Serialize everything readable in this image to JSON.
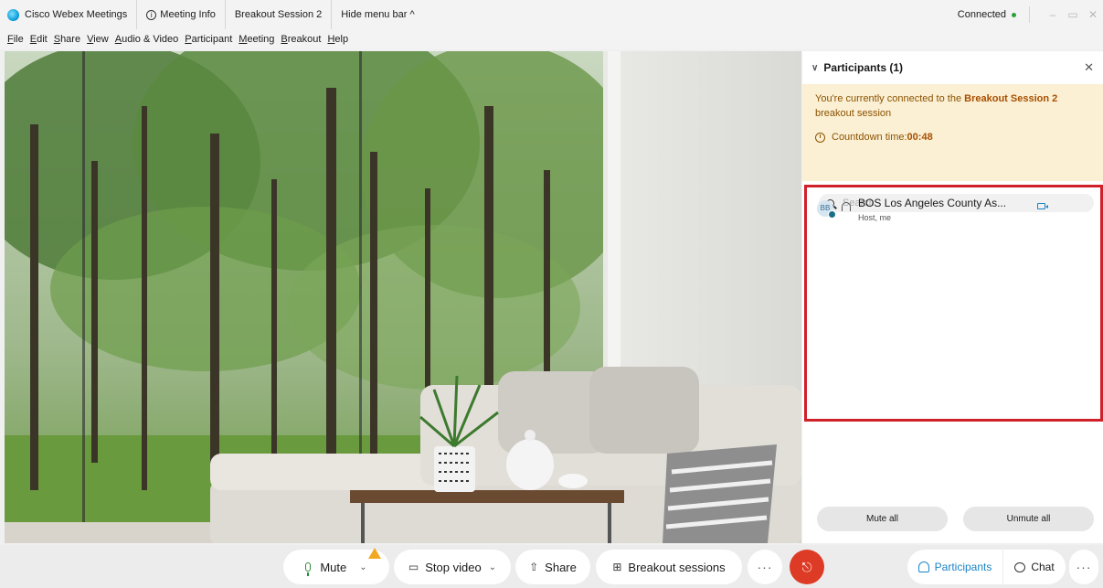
{
  "titlebar": {
    "app_name": "Cisco Webex Meetings",
    "meeting_info": "Meeting Info",
    "session": "Breakout Session 2",
    "hide_menu": "Hide menu bar ^",
    "status": "Connected",
    "minimize": "–",
    "maximize": "▭",
    "close": "✕"
  },
  "menubar": {
    "items": [
      "File",
      "Edit",
      "Share",
      "View",
      "Audio & Video",
      "Participant",
      "Meeting",
      "Breakout",
      "Help"
    ]
  },
  "panel": {
    "title": "Participants (1)",
    "banner_prefix": "You're currently connected to the ",
    "banner_session": "Breakout Session 2",
    "banner_suffix": "breakout session",
    "countdown_label": "Countdown time: ",
    "countdown_value": "00:48",
    "search_placeholder": "Search",
    "participants": [
      {
        "initials": "BB",
        "name": "BOS Los Angeles County As...",
        "role": "Host, me"
      }
    ],
    "mute_all": "Mute all",
    "unmute_all": "Unmute all"
  },
  "controls": {
    "mute": "Mute",
    "stop_video": "Stop video",
    "share": "Share",
    "breakout": "Breakout sessions",
    "more": "···",
    "participants": "Participants",
    "chat": "Chat"
  },
  "colors": {
    "accent": "#1a84c7",
    "end_meeting": "#dd3b25",
    "banner_bg": "#fbf0d4",
    "highlight_border": "#d0202a",
    "connected": "#2aa23b"
  }
}
